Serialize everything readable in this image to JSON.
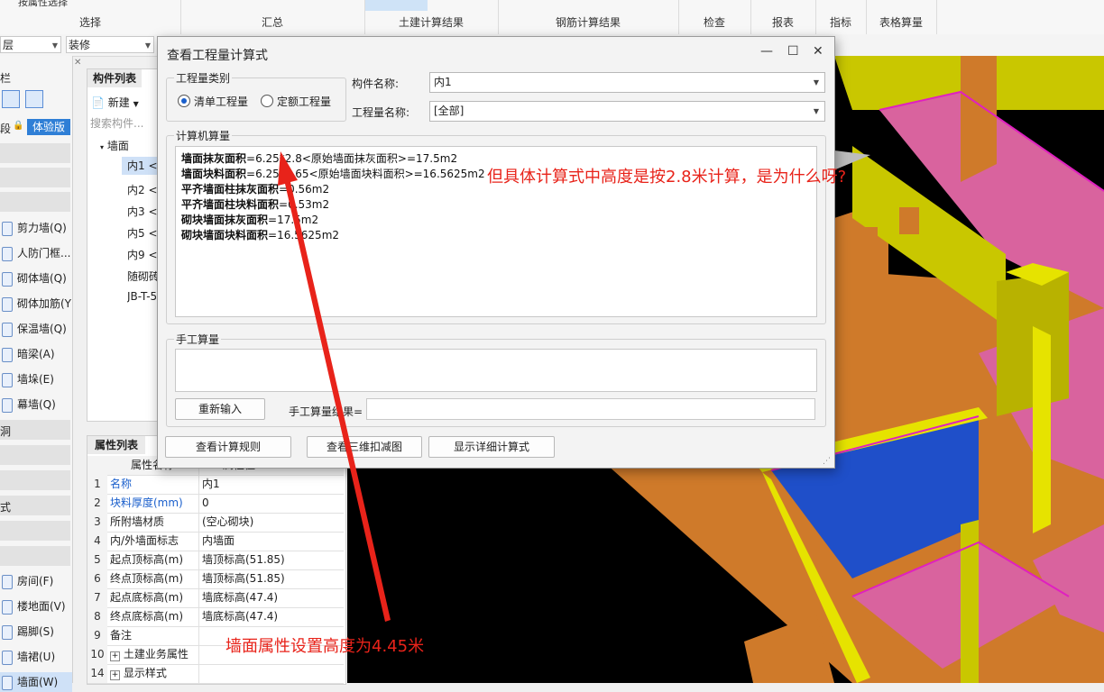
{
  "ribbon": {
    "top_button": "按属性选择",
    "groups": [
      "选择",
      "汇总",
      "土建计算结果",
      "钢筋计算结果",
      "检查",
      "报表",
      "指标",
      "表格算量"
    ]
  },
  "toolbar2": {
    "floor_combo": "层",
    "type_combo": "装修"
  },
  "leftnav": {
    "header": "栏",
    "edition_left": "段",
    "edition_badge": "体验版",
    "items": [
      {
        "label": "剪力墙(Q)"
      },
      {
        "label": "人防门框..."
      },
      {
        "label": "砌体墙(Q)"
      },
      {
        "label": "砌体加筋(Y"
      },
      {
        "label": "保温墙(Q)"
      },
      {
        "label": "暗梁(A)"
      },
      {
        "label": "墙垛(E)"
      },
      {
        "label": "幕墙(Q)"
      },
      {
        "label": "洞"
      },
      {
        "label": "式"
      },
      {
        "label": "房间(F)"
      },
      {
        "label": "楼地面(V)"
      },
      {
        "label": "踢脚(S)"
      },
      {
        "label": "墙裙(U)"
      },
      {
        "label": "墙面(W)"
      }
    ]
  },
  "component_list": {
    "tab": "构件列表",
    "new_button": "新建",
    "search_placeholder": "搜索构件...",
    "tree_root": "墙面",
    "items": [
      "内1 <",
      "内2 <",
      "内3 <",
      "内5 <",
      "内9 <",
      "随砌砖",
      "JB-T-5"
    ]
  },
  "property_list": {
    "tab": "属性列表",
    "col_name": "属性名称",
    "col_value": "属性值",
    "rows": [
      {
        "n": "1",
        "k": "名称",
        "v": "内1"
      },
      {
        "n": "2",
        "k": "块料厚度(mm)",
        "v": "0"
      },
      {
        "n": "3",
        "k": "所附墙材质",
        "v": "(空心砌块)"
      },
      {
        "n": "4",
        "k": "内/外墙面标志",
        "v": "内墙面"
      },
      {
        "n": "5",
        "k": "起点顶标高(m)",
        "v": "墙顶标高(51.85)"
      },
      {
        "n": "6",
        "k": "终点顶标高(m)",
        "v": "墙顶标高(51.85)"
      },
      {
        "n": "7",
        "k": "起点底标高(m)",
        "v": "墙底标高(47.4)"
      },
      {
        "n": "8",
        "k": "终点底标高(m)",
        "v": "墙底标高(47.4)"
      },
      {
        "n": "9",
        "k": "备注",
        "v": ""
      },
      {
        "n": "10",
        "k": "土建业务属性",
        "v": ""
      },
      {
        "n": "14",
        "k": "显示样式",
        "v": ""
      }
    ]
  },
  "dialog": {
    "title": "查看工程量计算式",
    "qty_type_group": "工程量类别",
    "radio_list": "清单工程量",
    "radio_quota": "定额工程量",
    "component_name_label": "构件名称:",
    "component_name_value": "内1",
    "qty_name_label": "工程量名称:",
    "qty_name_value": "[全部]",
    "computer_group": "计算机算量",
    "lines": [
      {
        "name": "墙面抹灰面积",
        "expr": "=6.25*2.8<原始墙面抹灰面积>=17.5m2"
      },
      {
        "name": "墙面块料面积",
        "expr": "=6.25*2.65<原始墙面块料面积>=16.5625m2"
      },
      {
        "name": "平齐墙面柱抹灰面积",
        "expr": "=0.56m2"
      },
      {
        "name": "平齐墙面柱块料面积",
        "expr": "=0.53m2"
      },
      {
        "name": "砌块墙面抹灰面积",
        "expr": "=17.5m2"
      },
      {
        "name": "砌块墙面块料面积",
        "expr": "=16.5625m2"
      }
    ],
    "manual_group": "手工算量",
    "reenter_button": "重新输入",
    "manual_result_label": "手工算量结果=",
    "rules_button": "查看计算规则",
    "deduct_button": "查看三维扣减图",
    "detail_button": "显示详细计算式"
  },
  "annotations": {
    "question": "但具体计算式中高度是按2.8米计算，是为什么呀?",
    "note": "墙面属性设置高度为4.45米"
  },
  "colors": {
    "annotation": "#e8231a",
    "accent": "#2f7fd6",
    "wall_yellow": "#c9c700",
    "floor_pink": "#d9639e",
    "wall_orange": "#cf7a2a",
    "room_blue": "#1f4fc9"
  }
}
